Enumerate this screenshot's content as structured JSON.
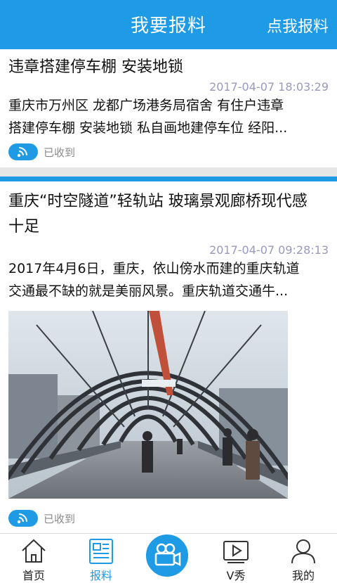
{
  "header": {
    "title": "我要报料",
    "action_label": "点我报料"
  },
  "feed": [
    {
      "title": "违章搭建停车棚 安装地锁",
      "time": "2017-04-07 18:03:29",
      "summary_line1": "重庆市万州区 龙都广场港务局宿舍 有住户违章",
      "summary_line2": "搭建停车棚 安装地锁 私自画地建停车位 经阳...",
      "status": "已收到"
    },
    {
      "title_line1": "重庆“时空隧道”轻轨站 玻璃景观廊桥现代感",
      "title_line2": "十足",
      "time": "2017-04-07 09:28:13",
      "summary_line1": "2017年4月6日，重庆，依山傍水而建的重庆轨道",
      "summary_line2": "交通最不缺的就是美丽风景。重庆轨道交通牛...",
      "status": "已收到"
    }
  ],
  "tabs": [
    {
      "label": "首页",
      "icon": "home-icon"
    },
    {
      "label": "报料",
      "icon": "news-report-icon"
    },
    {
      "label": "",
      "icon": "video-camera-icon"
    },
    {
      "label": "V秀",
      "icon": "play-video-icon"
    },
    {
      "label": "我的",
      "icon": "user-profile-icon"
    }
  ],
  "colors": {
    "accent": "#1e9be4",
    "time_text": "#9999bb",
    "status_text": "#8a8a8a"
  }
}
